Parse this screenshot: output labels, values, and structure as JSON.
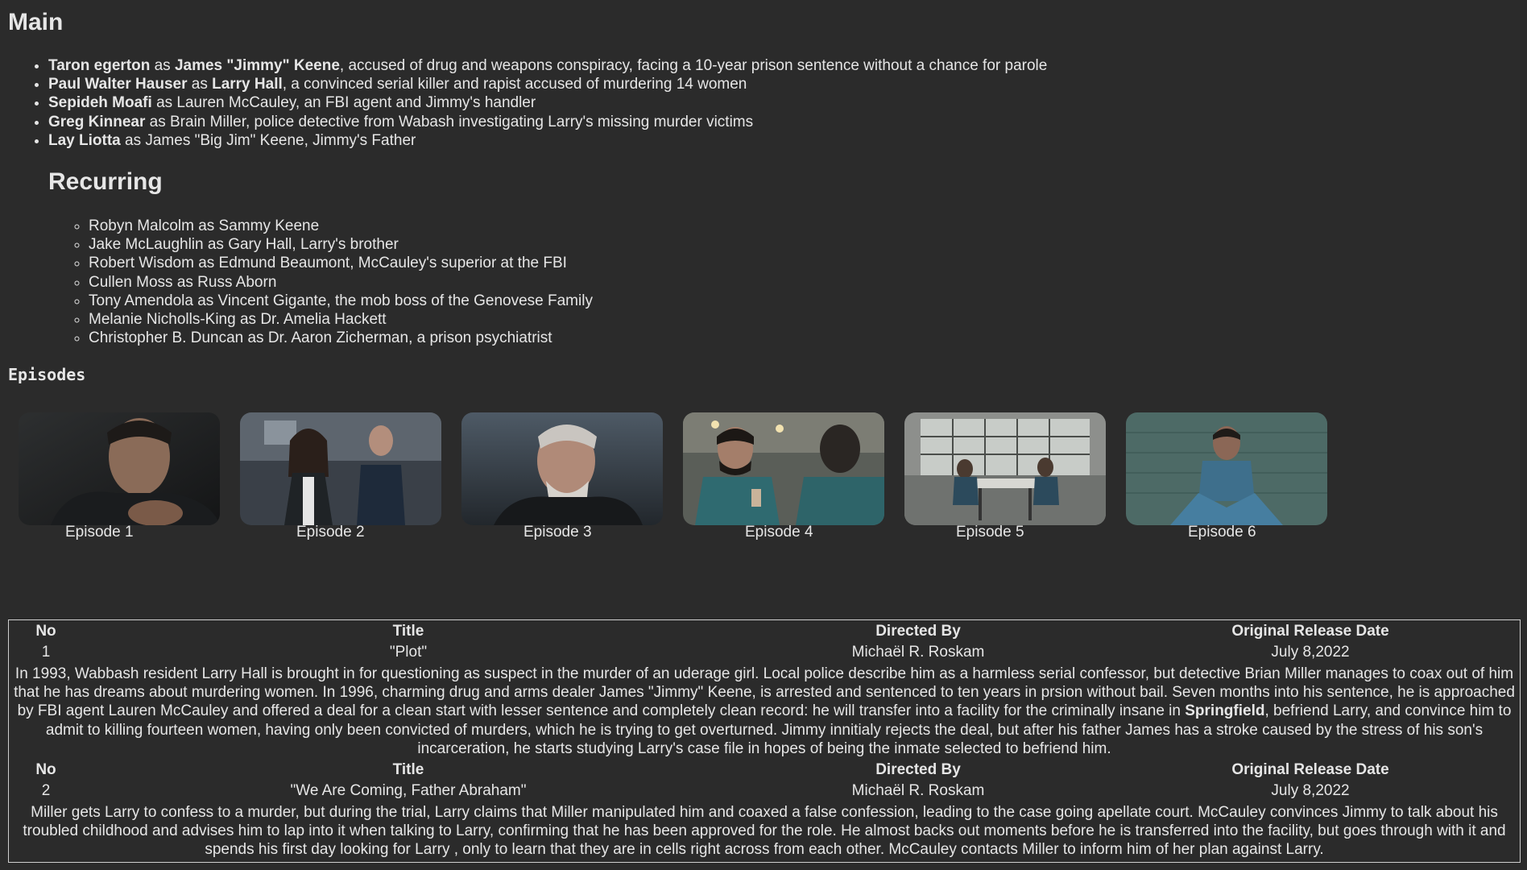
{
  "main": {
    "heading": "Main",
    "cast": [
      {
        "actor": "Taron egerton",
        "as": " as ",
        "role": "James \"Jimmy\" Keene",
        "desc": ", accused of drug and weapons conspiracy, facing a 10-year prison sentence without a chance for parole"
      },
      {
        "actor": "Paul Walter Hauser",
        "as": " as ",
        "role": "Larry Hall",
        "desc": ", a convinced serial killer and rapist accused of murdering 14 women"
      },
      {
        "actor": "Sepideh Moafi",
        "desc": " as Lauren McCauley, an FBI agent and Jimmy's handler"
      },
      {
        "actor": "Greg Kinnear",
        "desc": " as Brain Miller, police detective from Wabash investigating Larry's missing murder victims"
      },
      {
        "actor": "Lay Liotta",
        "desc": " as James \"Big Jim\" Keene, Jimmy's Father"
      }
    ]
  },
  "recurring": {
    "heading": "Recurring",
    "items": [
      "Robyn Malcolm as Sammy Keene",
      "Jake McLaughlin as Gary Hall, Larry's brother",
      "Robert Wisdom as Edmund Beaumont, McCauley's superior at the FBI",
      "Cullen Moss as Russ Aborn",
      "Tony Amendola as Vincent Gigante, the mob boss of the Genovese Family",
      "Melanie Nicholls-King as Dr. Amelia Hackett",
      "Christopher B. Duncan as Dr. Aaron Zicherman, a prison psychiatrist"
    ]
  },
  "episodes": {
    "heading": "Episodes",
    "cards": [
      {
        "label": "Episode 1"
      },
      {
        "label": "Episode 2"
      },
      {
        "label": "Episode 3"
      },
      {
        "label": "Episode 4"
      },
      {
        "label": "Episode 5"
      },
      {
        "label": "Episode 6"
      }
    ]
  },
  "table": {
    "headers": {
      "no": "No",
      "title": "Title",
      "directed": "Directed By",
      "date": "Original Release Date"
    },
    "rows": [
      {
        "no": "1",
        "title": "\"Plot\"",
        "directed": "Michaël R. Roskam",
        "date": "July 8,2022",
        "summary_a": "In 1993, Wabbash resident Larry Hall is brought in for questioning as suspect in the murder of an uderage girl. Local police describe him as a harmless serial confessor, but detective Brian Miller manages to coax out of him that he has dreams about murdering women. In 1996, charming drug and arms dealer James \"Jimmy\" Keene, is arrested and sentenced to ten years in prsion without bail. Seven months into his sentence, he is approached by FBI agent Lauren McCauley and offered a deal for a clean start with lesser sentence and completely clean record: he will transfer into a facility for the criminally insane in ",
        "summary_bold": "Springfield",
        "summary_b": ", befriend Larry, and convince him to admit to killing fourteen women, having only been convicted of murders, which he is trying to get overturned. Jimmy innitialy rejects the deal, but after his father James has a stroke caused by the stress of his son's incarceration, he starts studying Larry's case file in hopes of being the inmate selected to befriend him."
      },
      {
        "no": "2",
        "title": "\"We Are Coming, Father Abraham\"",
        "directed": "Michaël R. Roskam",
        "date": "July 8,2022",
        "summary_a": "Miller gets Larry to confess to a murder, but during the trial, Larry claims that Miller manipulated him and coaxed a false confession, leading to the case going apellate court. McCauley convinces Jimmy to talk about his troubled childhood and advises him to lap into it when talking to Larry, confirming that he has been approved for the role. He almost backs out moments before he is transferred into the facility, but goes through with it and spends his first day looking for Larry , only to learn that they are in cells right across from each other. McCauley contacts Miller to inform him of her plan against Larry."
      }
    ]
  }
}
